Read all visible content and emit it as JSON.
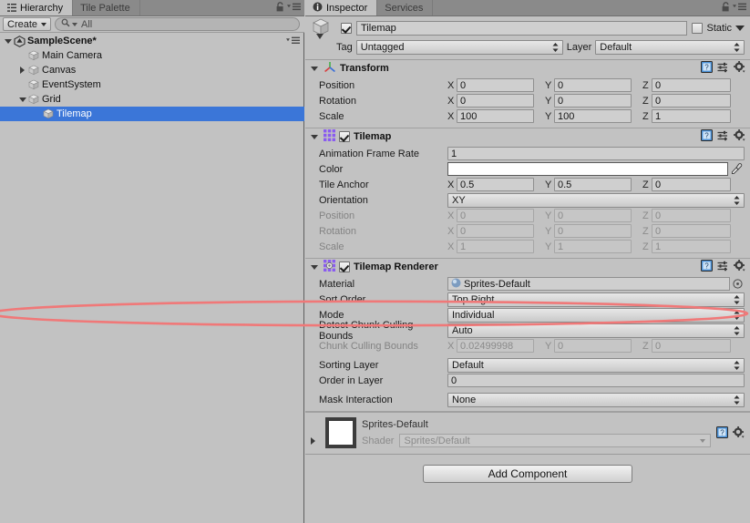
{
  "hierarchy": {
    "tabs": [
      {
        "label": "Hierarchy",
        "icon": "hierarchy-icon",
        "active": true
      },
      {
        "label": "Tile Palette",
        "icon": "",
        "active": false
      }
    ],
    "toolbar": {
      "create_label": "Create",
      "search_placeholder": "All",
      "search_value": "All",
      "search_icon": "search-icon"
    },
    "tree": [
      {
        "label": "SampleScene*",
        "depth": 0,
        "twist": "down",
        "icon": "unity-scene-icon",
        "selected": false,
        "bold": true
      },
      {
        "label": "Main Camera",
        "depth": 1,
        "twist": "none",
        "icon": "gameobject-cube-icon",
        "selected": false,
        "bold": false
      },
      {
        "label": "Canvas",
        "depth": 1,
        "twist": "right",
        "icon": "gameobject-cube-icon",
        "selected": false,
        "bold": false
      },
      {
        "label": "EventSystem",
        "depth": 1,
        "twist": "none",
        "icon": "gameobject-cube-icon",
        "selected": false,
        "bold": false
      },
      {
        "label": "Grid",
        "depth": 1,
        "twist": "down",
        "icon": "gameobject-cube-icon",
        "selected": false,
        "bold": false
      },
      {
        "label": "Tilemap",
        "depth": 2,
        "twist": "none",
        "icon": "gameobject-cube-icon",
        "selected": true,
        "bold": false
      }
    ],
    "selection_color": "#3b76d8"
  },
  "inspector": {
    "tabs": [
      {
        "label": "Inspector",
        "icon": "info-icon",
        "active": true
      },
      {
        "label": "Services",
        "icon": "",
        "active": false
      }
    ],
    "gameobject": {
      "enabled": true,
      "name": "Tilemap",
      "static_label": "Static",
      "static_checked": false,
      "tag_label": "Tag",
      "tag_value": "Untagged",
      "layer_label": "Layer",
      "layer_value": "Default"
    },
    "components": [
      {
        "name": "Transform",
        "icon": "transform-axis-icon",
        "has_checkbox": false,
        "expanded": true,
        "rows": [
          {
            "type": "vector3",
            "label": "Position",
            "x": "0",
            "y": "0",
            "z": "0",
            "dim": false
          },
          {
            "type": "vector3",
            "label": "Rotation",
            "x": "0",
            "y": "0",
            "z": "0",
            "dim": false
          },
          {
            "type": "vector3",
            "label": "Scale",
            "x": "100",
            "y": "100",
            "z": "1",
            "dim": false
          }
        ]
      },
      {
        "name": "Tilemap",
        "icon": "tilemap-grid-icon",
        "has_checkbox": true,
        "checked": true,
        "expanded": true,
        "rows": [
          {
            "type": "text",
            "label": "Animation Frame Rate",
            "value": "1",
            "dim": false
          },
          {
            "type": "color",
            "label": "Color",
            "value": "#ffffff",
            "eyedropper": true
          },
          {
            "type": "vector3",
            "label": "Tile Anchor",
            "x": "0.5",
            "y": "0.5",
            "z": "0",
            "dim": false
          },
          {
            "type": "dropdown",
            "label": "Orientation",
            "value": "XY",
            "dim": false
          },
          {
            "type": "vector3",
            "label": "Position",
            "x": "0",
            "y": "0",
            "z": "0",
            "dim": true
          },
          {
            "type": "vector3",
            "label": "Rotation",
            "x": "0",
            "y": "0",
            "z": "0",
            "dim": true
          },
          {
            "type": "vector3",
            "label": "Scale",
            "x": "1",
            "y": "1",
            "z": "1",
            "dim": true
          }
        ]
      },
      {
        "name": "Tilemap Renderer",
        "icon": "tilemap-renderer-icon",
        "has_checkbox": true,
        "checked": true,
        "expanded": true,
        "rows": [
          {
            "type": "object",
            "label": "Material",
            "value": "Sprites-Default",
            "dim": false
          },
          {
            "type": "dropdown",
            "label": "Sort Order",
            "value": "Top Right",
            "dim": false
          },
          {
            "type": "dropdown",
            "label": "Mode",
            "value": "Individual",
            "dim": false,
            "highlighted": true
          },
          {
            "type": "dropdown",
            "label": "Detect Chunk Culling Bounds",
            "value": "Auto",
            "dim": false
          },
          {
            "type": "vector3",
            "label": "Chunk Culling Bounds",
            "x": "0.02499998",
            "y": "0",
            "z": "0",
            "dim": true
          },
          {
            "type": "spacer"
          },
          {
            "type": "dropdown",
            "label": "Sorting Layer",
            "value": "Default",
            "dim": false
          },
          {
            "type": "text",
            "label": "Order in Layer",
            "value": "0",
            "dim": false
          },
          {
            "type": "spacer"
          },
          {
            "type": "dropdown",
            "label": "Mask Interaction",
            "value": "None",
            "dim": false
          }
        ]
      }
    ],
    "material_preview": {
      "name": "Sprites-Default",
      "shader_label": "Shader",
      "shader_value": "Sprites/Default",
      "swatch_color": "#ffffff"
    },
    "add_component_label": "Add Component"
  },
  "annotation": {
    "shape": "ellipse",
    "color": "#f07070",
    "targets": "Mode row"
  }
}
